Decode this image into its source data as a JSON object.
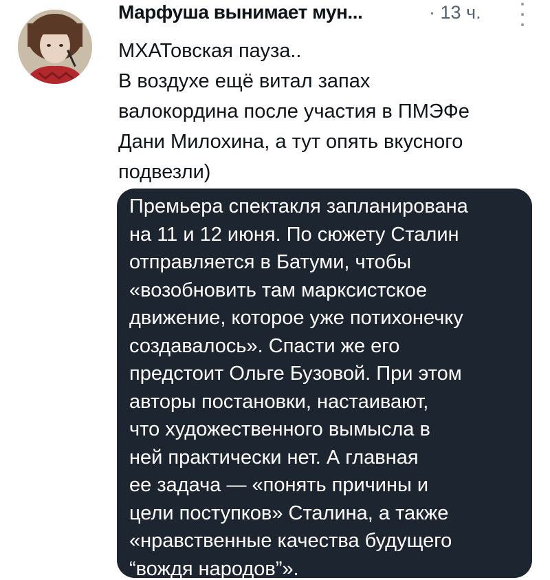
{
  "author": {
    "name": "Марфуша вынимает мун...",
    "timestamp": "13 ч.",
    "avatar_icon": "avatar-photo"
  },
  "more_icon": "more-vertical-icon",
  "tweet_text_lines": [
    "МХАТовская пауза..",
    "В воздухе ещё витал запах",
    "валокордина после участия в ПМЭФе",
    "Дани Милохина, а тут опять вкусного",
    "подвезли)"
  ],
  "media_text_lines": [
    "Премьера спектакля запланирована",
    "на 11 и 12 июня. По сюжету Сталин",
    "отправляется в Батуми, чтобы",
    "«возобновить там марксистское",
    "движение, которое уже потихонечку",
    "создавалось». Спасти же его",
    "предстоит Ольге Бузовой. При этом",
    "авторы постановки, настаивают,",
    "что художественного вымысла в",
    "ней практически нет. А главная",
    "ее задача — «понять причины и",
    "цели поступков» Сталина, а также",
    "«нравственные качества будущего",
    "“вождя народов”»."
  ],
  "colors": {
    "media_background": "#1d2530",
    "text_primary": "#0f1419",
    "text_secondary": "#536471"
  }
}
